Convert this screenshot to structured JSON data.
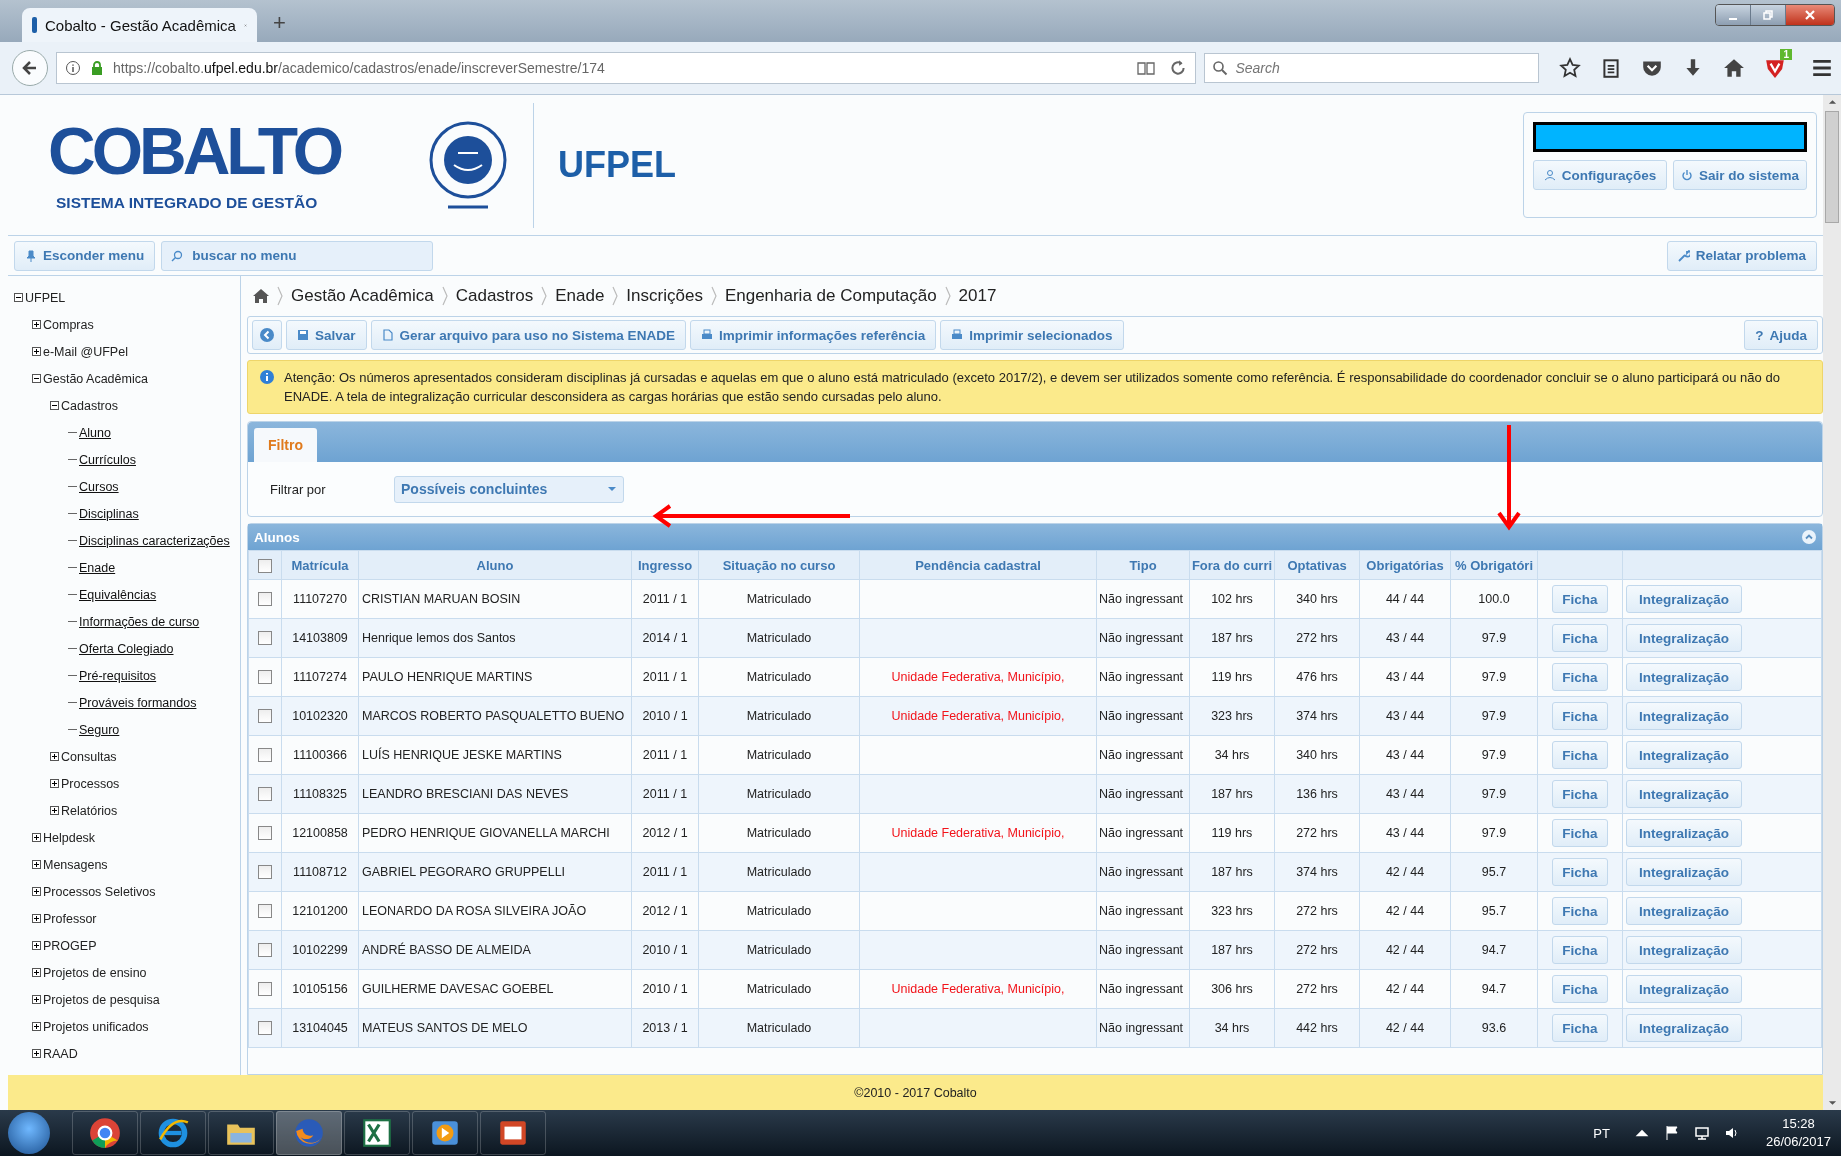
{
  "browser": {
    "tab_title": "Cobalto - Gestão Acadêmica",
    "new_tab": "+",
    "url_prefix": "https://cobalto.",
    "url_host": "ufpel.edu.br",
    "url_path": "/academico/cadastros/enade/inscreverSemestre/174",
    "search_placeholder": "Search",
    "badge": "1"
  },
  "header": {
    "logo": "COBALTO",
    "tagline": "SISTEMA INTEGRADO DE GESTÃO",
    "institution": "UFPEL",
    "user_buttons": [
      "Configurações",
      "Sair do sistema"
    ]
  },
  "menubar": {
    "hide_menu": "Esconder menu",
    "menu_search_placeholder": "buscar no menu",
    "report": "Relatar problema"
  },
  "sidebar": {
    "tree": [
      {
        "label": "UFPEL",
        "expanded": true,
        "children": [
          {
            "label": "Compras",
            "expanded": false
          },
          {
            "label": "e-Mail @UFPel",
            "expanded": false
          },
          {
            "label": "Gestão Acadêmica",
            "expanded": true,
            "children": [
              {
                "label": "Cadastros",
                "expanded": true,
                "children": [
                  {
                    "label": "Aluno"
                  },
                  {
                    "label": "Currículos"
                  },
                  {
                    "label": "Cursos"
                  },
                  {
                    "label": "Disciplinas"
                  },
                  {
                    "label": "Disciplinas caracterizações"
                  },
                  {
                    "label": "Enade"
                  },
                  {
                    "label": "Equivalências"
                  },
                  {
                    "label": "Informações de curso"
                  },
                  {
                    "label": "Oferta Colegiado"
                  },
                  {
                    "label": "Pré-requisitos"
                  },
                  {
                    "label": "Prováveis formandos"
                  },
                  {
                    "label": "Seguro"
                  }
                ]
              },
              {
                "label": "Consultas",
                "expanded": false
              },
              {
                "label": "Processos",
                "expanded": false
              },
              {
                "label": "Relatórios",
                "expanded": false
              }
            ]
          },
          {
            "label": "Helpdesk",
            "expanded": false
          },
          {
            "label": "Mensagens",
            "expanded": false
          },
          {
            "label": "Processos Seletivos",
            "expanded": false
          },
          {
            "label": "Professor",
            "expanded": false
          },
          {
            "label": "PROGEP",
            "expanded": false
          },
          {
            "label": "Projetos de ensino",
            "expanded": false
          },
          {
            "label": "Projetos de pesquisa",
            "expanded": false
          },
          {
            "label": "Projetos unificados",
            "expanded": false
          },
          {
            "label": "RAAD",
            "expanded": false
          }
        ]
      }
    ]
  },
  "breadcrumb": [
    "Gestão Acadêmica",
    "Cadastros",
    "Enade",
    "Inscrições",
    "Engenharia de Computação",
    "2017"
  ],
  "toolbar": [
    {
      "kind": "back"
    },
    {
      "kind": "save",
      "label": "Salvar"
    },
    {
      "kind": "file",
      "label": "Gerar arquivo para uso no Sistema ENADE"
    },
    {
      "kind": "print",
      "label": "Imprimir informações referência"
    },
    {
      "kind": "print",
      "label": "Imprimir selecionados"
    }
  ],
  "help": {
    "icon": "?",
    "label": "Ajuda"
  },
  "alert": "Atenção: Os números apresentados consideram disciplinas já cursadas e aquelas em que o aluno está matriculado (exceto 2017/2), e devem ser utilizados somente como referência. É responsabilidade do coordenador concluir se o aluno participará ou não do ENADE. A tela de integralização curricular desconsidera as cargas horárias que estão sendo cursadas pelo aluno.",
  "filter": {
    "tab": "Filtro",
    "label": "Filtrar por",
    "value": "Possíveis concluintes"
  },
  "table": {
    "title": "Alunos",
    "select_all_checked": false,
    "columns": [
      "Matrícula",
      "Aluno",
      "Ingresso",
      "Situação no curso",
      "Pendência cadastral",
      "Tipo",
      "Fora do curri",
      "Optativas",
      "Obrigatórias",
      "% Obrigatóri"
    ],
    "rows": [
      {
        "checked": false,
        "cells": [
          "11107270",
          "CRISTIAN MARUAN BOSIN",
          "2011 / 1",
          "Matriculado",
          "",
          "Não ingressant",
          "102 hrs",
          "340 hrs",
          "44 / 44",
          "100.0"
        ],
        "actions": [
          "Ficha",
          "Integralização"
        ]
      },
      {
        "checked": false,
        "cells": [
          "14103809",
          "Henrique lemos dos Santos",
          "2014 / 1",
          "Matriculado",
          "",
          "Não ingressant",
          "187 hrs",
          "272 hrs",
          "43 / 44",
          "97.9"
        ],
        "actions": [
          "Ficha",
          "Integralização"
        ]
      },
      {
        "checked": false,
        "cells": [
          "11107274",
          "PAULO HENRIQUE MARTINS",
          "2011 / 1",
          "Matriculado",
          "Unidade Federativa, Município,",
          "Não ingressant",
          "119 hrs",
          "476 hrs",
          "43 / 44",
          "97.9"
        ],
        "actions": [
          "Ficha",
          "Integralização"
        ]
      },
      {
        "checked": false,
        "cells": [
          "10102320",
          "MARCOS ROBERTO PASQUALETTO BUENO",
          "2010 / 1",
          "Matriculado",
          "Unidade Federativa, Município,",
          "Não ingressant",
          "323 hrs",
          "374 hrs",
          "43 / 44",
          "97.9"
        ],
        "actions": [
          "Ficha",
          "Integralização"
        ]
      },
      {
        "checked": false,
        "cells": [
          "11100366",
          "LUÍS HENRIQUE JESKE MARTINS",
          "2011 / 1",
          "Matriculado",
          "",
          "Não ingressant",
          "34 hrs",
          "340 hrs",
          "43 / 44",
          "97.9"
        ],
        "actions": [
          "Ficha",
          "Integralização"
        ]
      },
      {
        "checked": false,
        "cells": [
          "11108325",
          "LEANDRO BRESCIANI DAS NEVES",
          "2011 / 1",
          "Matriculado",
          "",
          "Não ingressant",
          "187 hrs",
          "136 hrs",
          "43 / 44",
          "97.9"
        ],
        "actions": [
          "Ficha",
          "Integralização"
        ]
      },
      {
        "checked": false,
        "cells": [
          "12100858",
          "PEDRO HENRIQUE GIOVANELLA MARCHI",
          "2012 / 1",
          "Matriculado",
          "Unidade Federativa, Município,",
          "Não ingressant",
          "119 hrs",
          "272 hrs",
          "43 / 44",
          "97.9"
        ],
        "actions": [
          "Ficha",
          "Integralização"
        ]
      },
      {
        "checked": false,
        "cells": [
          "11108712",
          "GABRIEL PEGORARO GRUPPELLI",
          "2011 / 1",
          "Matriculado",
          "",
          "Não ingressant",
          "187 hrs",
          "374 hrs",
          "42 / 44",
          "95.7"
        ],
        "actions": [
          "Ficha",
          "Integralização"
        ]
      },
      {
        "checked": false,
        "cells": [
          "12101200",
          "LEONARDO DA ROSA SILVEIRA JOÃO",
          "2012 / 1",
          "Matriculado",
          "",
          "Não ingressant",
          "323 hrs",
          "272 hrs",
          "42 / 44",
          "95.7"
        ],
        "actions": [
          "Ficha",
          "Integralização"
        ]
      },
      {
        "checked": false,
        "cells": [
          "10102299",
          "ANDRÉ BASSO DE ALMEIDA",
          "2010 / 1",
          "Matriculado",
          "",
          "Não ingressant",
          "187 hrs",
          "272 hrs",
          "42 / 44",
          "94.7"
        ],
        "actions": [
          "Ficha",
          "Integralização"
        ]
      },
      {
        "checked": false,
        "cells": [
          "10105156",
          "GUILHERME DAVESAC GOEBEL",
          "2010 / 1",
          "Matriculado",
          "Unidade Federativa, Município,",
          "Não ingressant",
          "306 hrs",
          "272 hrs",
          "42 / 44",
          "94.7"
        ],
        "actions": [
          "Ficha",
          "Integralização"
        ]
      },
      {
        "checked": false,
        "cells": [
          "13104045",
          "MATEUS SANTOS DE MELO",
          "2013 / 1",
          "Matriculado",
          "",
          "Não ingressant",
          "34 hrs",
          "442 hrs",
          "42 / 44",
          "93.6"
        ],
        "actions": [
          "Ficha",
          "Integralização"
        ]
      }
    ]
  },
  "footer": "©2010 - 2017 Cobalto",
  "taskbar": {
    "language": "PT",
    "time": "15:28",
    "date": "26/06/2017"
  }
}
